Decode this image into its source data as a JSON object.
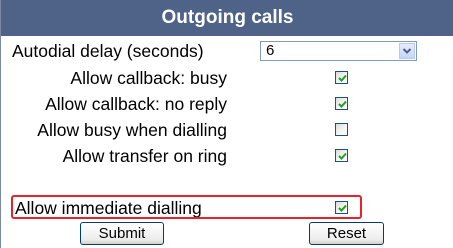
{
  "title": "Outgoing calls",
  "autodial": {
    "label": "Autodial delay (seconds)",
    "value": "6"
  },
  "options": [
    {
      "label": "Allow callback: busy",
      "checked": true
    },
    {
      "label": "Allow callback: no reply",
      "checked": true
    },
    {
      "label": "Allow busy when dialling",
      "checked": false
    },
    {
      "label": "Allow transfer on ring",
      "checked": true
    },
    {
      "label": "Allow immediate dialling",
      "checked": true
    }
  ],
  "buttons": {
    "submit": "Submit",
    "reset": "Reset"
  },
  "colors": {
    "header": "#4f6287",
    "highlight": "#e8212b",
    "check": "#21a121"
  }
}
